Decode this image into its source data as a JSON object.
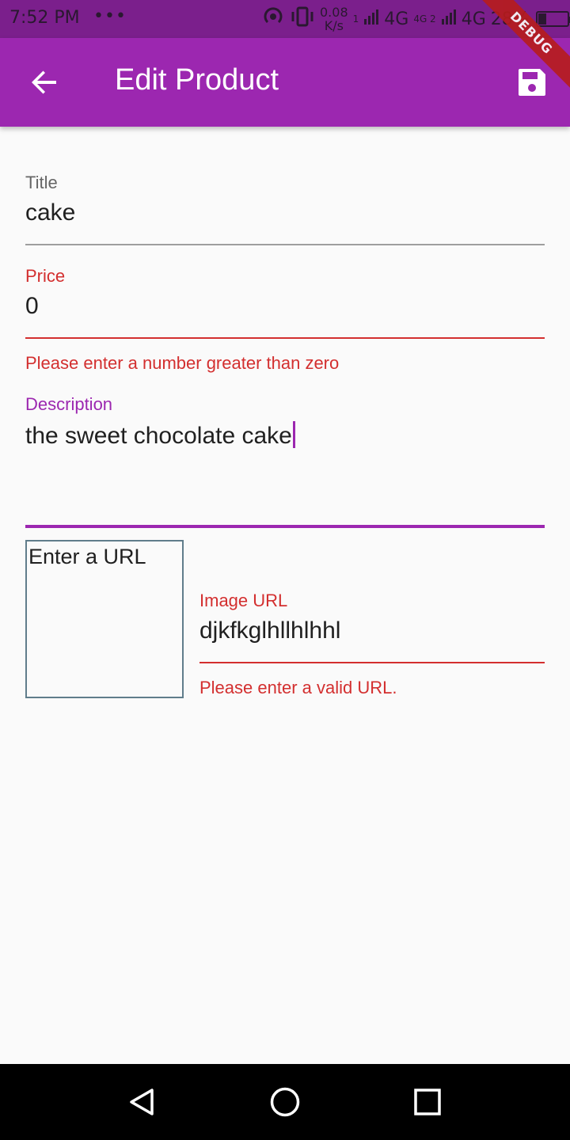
{
  "status_bar": {
    "time": "7:52 PM",
    "dots": "•••",
    "speed_value": "0.08",
    "speed_unit": "K/s",
    "sim1_num": "1",
    "network1": "4G",
    "sim2_label": "4G 2",
    "network2": "4G",
    "battery": "28%",
    "battery_level_percent": 28,
    "icons": [
      "hotspot-icon",
      "vibrate-icon",
      "signal-icon",
      "signal-icon",
      "battery-icon"
    ]
  },
  "app_bar": {
    "title": "Edit Product",
    "back_icon": "arrow-back-icon",
    "save_icon": "save-icon",
    "color": "#9c27b0"
  },
  "debug_banner": "DEBUG",
  "form": {
    "title": {
      "label": "Title",
      "value": "cake"
    },
    "price": {
      "label": "Price",
      "value": "0",
      "error": "Please enter a number greater than zero"
    },
    "description": {
      "label": "Description",
      "value": "the sweet chocolate cake"
    },
    "image_preview": {
      "placeholder": "Enter a URL"
    },
    "image_url": {
      "label": "Image URL",
      "value": "djkfkglhllhlhhl",
      "error": "Please enter a valid URL."
    }
  },
  "colors": {
    "primary": "#9c27b0",
    "error": "#d32f2f",
    "status_bar": "#7b1f8c"
  },
  "nav_bar": {
    "icons": [
      "back-triangle-icon",
      "home-circle-icon",
      "recents-square-icon"
    ]
  }
}
